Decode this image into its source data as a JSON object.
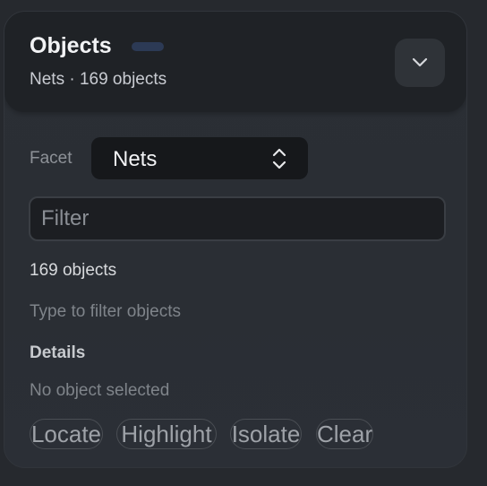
{
  "header": {
    "title": "Objects",
    "subtitle": "Nets · 169 objects",
    "collapse_icon": "chevron-down-icon"
  },
  "facet": {
    "label": "Facet",
    "selected": "Nets",
    "icon": "up-down-chevron-icon"
  },
  "filter": {
    "placeholder": "Filter",
    "value": ""
  },
  "results": {
    "count_text": "169 objects",
    "hint": "Type to filter objects"
  },
  "details": {
    "heading": "Details",
    "empty_text": "No object selected"
  },
  "actions": {
    "locate": "Locate",
    "highlight": "Highlight",
    "isolate": "Isolate",
    "clear": "Clear"
  },
  "colors": {
    "panel": "#2b2f35",
    "header": "#1f2226",
    "accent_pill": "#2c3a55"
  }
}
